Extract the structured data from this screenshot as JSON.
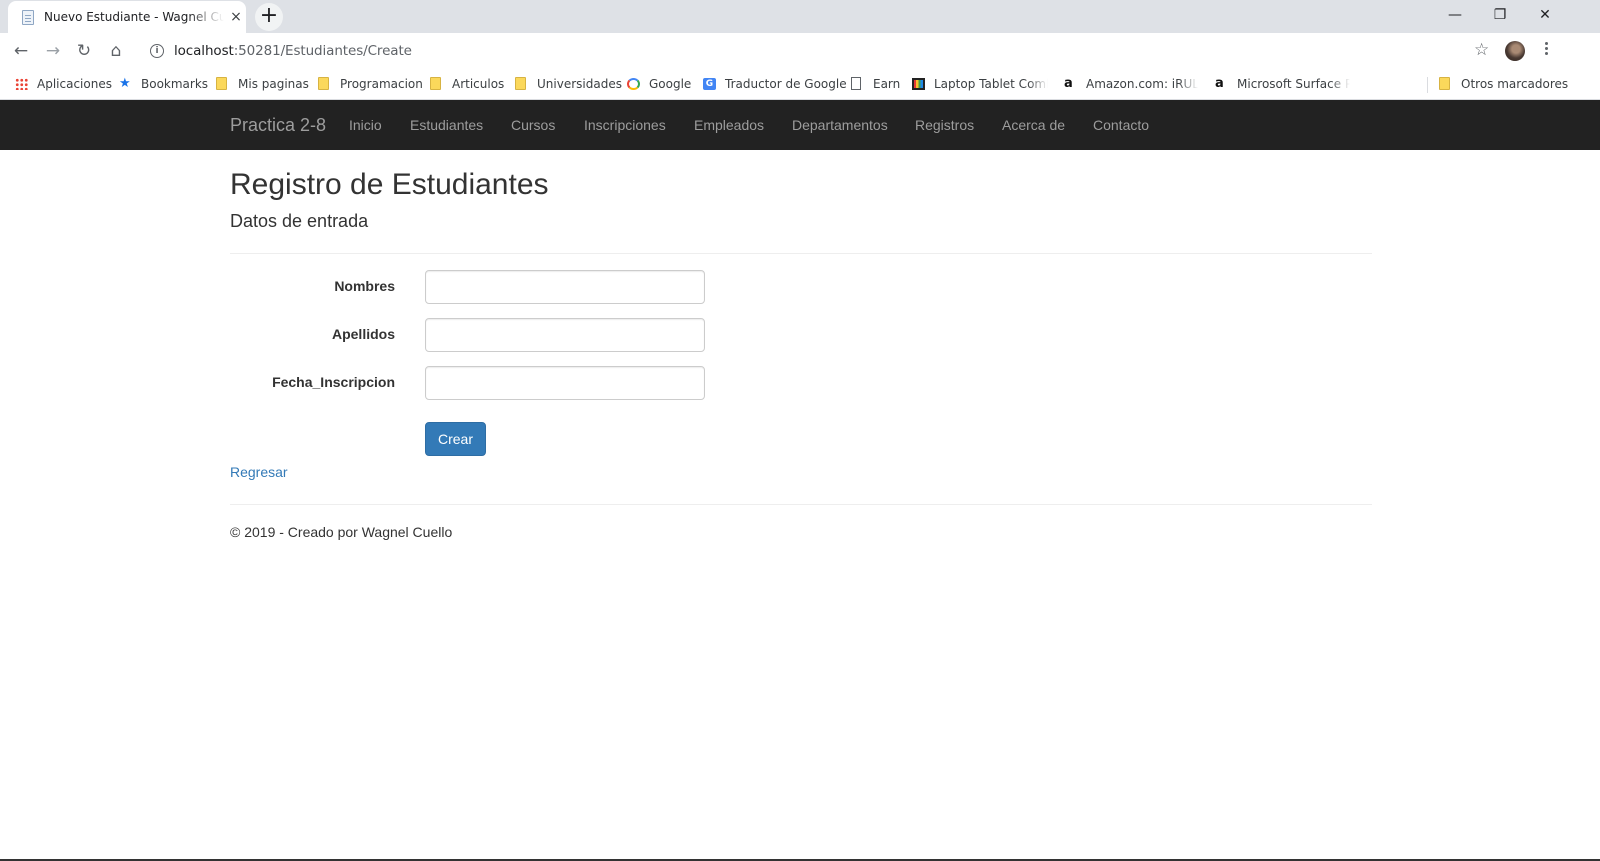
{
  "browser": {
    "tab_title": "Nuevo Estudiante - Wagnel Cuello",
    "tab_close": "×",
    "new_tab": "+",
    "window_controls": [
      "—",
      "❐",
      "✕"
    ],
    "nav": {
      "back": "←",
      "forward": "→",
      "reload": "↻",
      "home": "⌂"
    },
    "url_host": "localhost",
    "url_rest": ":50281/Estudiantes/Create",
    "bookmarks": [
      {
        "label": "Aplicaciones",
        "icon": "apps-icon"
      },
      {
        "label": "Bookmarks",
        "icon": "star-icon"
      },
      {
        "label": "Mis paginas",
        "icon": "folder-icon"
      },
      {
        "label": "Programacion",
        "icon": "folder-icon"
      },
      {
        "label": "Articulos",
        "icon": "folder-icon"
      },
      {
        "label": "Universidades",
        "icon": "folder-icon"
      },
      {
        "label": "Google",
        "icon": "google-icon"
      },
      {
        "label": "Traductor de Google",
        "icon": "google-translate-icon"
      },
      {
        "label": "Earn",
        "icon": "page-icon"
      },
      {
        "label": "Laptop Tablet Combo",
        "icon": "tv-icon"
      },
      {
        "label": "Amazon.com: iRULU",
        "icon": "amazon-icon"
      },
      {
        "label": "Microsoft Surface Pro",
        "icon": "amazon-icon"
      }
    ],
    "other_bookmarks": "Otros marcadores"
  },
  "navbar": {
    "brand": "Practica 2-8",
    "items": [
      "Inicio",
      "Estudiantes",
      "Cursos",
      "Inscripciones",
      "Empleados",
      "Departamentos",
      "Registros",
      "Acerca de",
      "Contacto"
    ]
  },
  "page": {
    "title": "Registro de Estudiantes",
    "subtitle": "Datos de entrada",
    "fields": [
      {
        "label": "Nombres",
        "value": ""
      },
      {
        "label": "Apellidos",
        "value": ""
      },
      {
        "label": "Fecha_Inscripcion",
        "value": ""
      }
    ],
    "submit_label": "Crear",
    "back_link": "Regresar",
    "footer": "© 2019 - Creado por Wagnel Cuello"
  },
  "colors": {
    "navbar_bg": "#222222",
    "navbar_text": "#9d9d9d",
    "primary": "#337ab7",
    "link": "#337ab7"
  }
}
